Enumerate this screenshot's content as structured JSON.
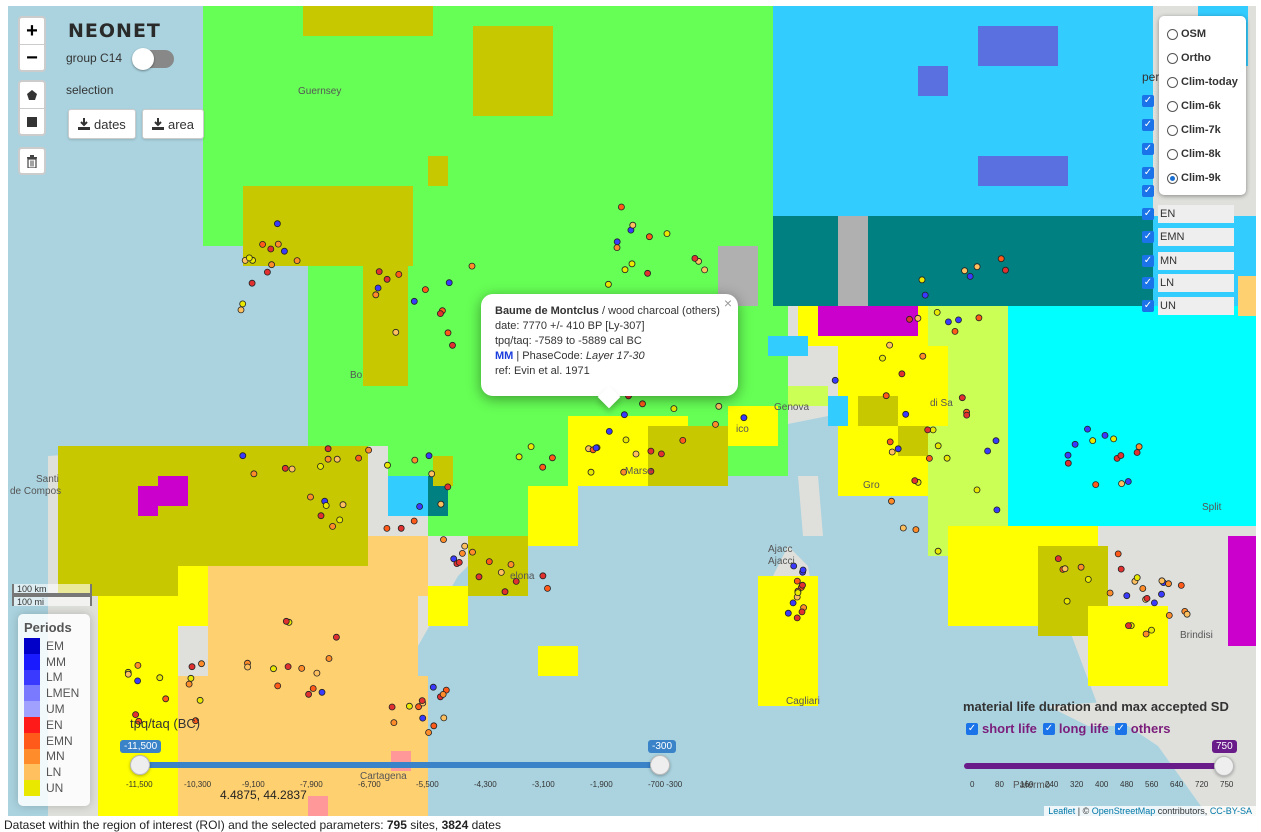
{
  "logo": {
    "part1": "NEO",
    "part2": "NET"
  },
  "controls": {
    "zoom_in": "+",
    "zoom_out": "−",
    "group_label": "group C14",
    "selection_label": "selection",
    "dates_button": "dates",
    "area_button": "area"
  },
  "layers": [
    "OSM",
    "Ortho",
    "Clim-today",
    "Clim-6k",
    "Clim-7k",
    "Clim-8k",
    "Clim-9k"
  ],
  "selected_layer": "Clim-9k",
  "period_panel": {
    "header": "per",
    "rows": [
      "EN",
      "EMN",
      "MN",
      "LN",
      "UN"
    ]
  },
  "popup": {
    "site": "Baume de Montclus",
    "material": " / wood charcoal (others)",
    "date_line": "date: 7770 +/- 410 BP [Ly-307]",
    "tpq_line": "tpq/taq: -7589 to -5889 cal BC",
    "period": "MM",
    "phase_label": " | PhaseCode: ",
    "phase_value": "Layer 17-30",
    "ref_line": "ref: Evin et al. 1971",
    "close": "×"
  },
  "scale": {
    "km": "100 km",
    "mi": "100 mi"
  },
  "legend": {
    "title": "Periods",
    "items": [
      {
        "label": "EM",
        "color": "#0000c8"
      },
      {
        "label": "MM",
        "color": "#1a1aff"
      },
      {
        "label": "LM",
        "color": "#3a3aff"
      },
      {
        "label": "LMEN",
        "color": "#7a7aff"
      },
      {
        "label": "UM",
        "color": "#a0a0ff"
      },
      {
        "label": "EN",
        "color": "#ff1a1a"
      },
      {
        "label": "EMN",
        "color": "#ff5a1a"
      },
      {
        "label": "MN",
        "color": "#ff8c2a"
      },
      {
        "label": "LN",
        "color": "#ffc060"
      },
      {
        "label": "UN",
        "color": "#e8e800"
      }
    ]
  },
  "tpq_slider": {
    "label": "tpq/taq (BC)",
    "min_tag": "-11,500",
    "max_tag": "-300",
    "ticks": [
      "-11,500",
      "-10,300",
      "-9,100",
      "-7,900",
      "-6,700",
      "-5,500",
      "-4,300",
      "-3,100",
      "-1,900",
      "-700 -300"
    ]
  },
  "coords": "4.4875, 44.2837",
  "mld": {
    "label": "material life duration and max accepted SD",
    "short": "short life",
    "long": "long life",
    "others": "others",
    "max_tag": "750",
    "ticks": [
      "0",
      "80",
      "160",
      "240",
      "320",
      "400",
      "480",
      "560",
      "640",
      "720",
      "750"
    ]
  },
  "cities": [
    {
      "name": "Guernsey"
    },
    {
      "name": "Bo"
    },
    {
      "name": "Santi"
    },
    {
      "name": "de Compos"
    },
    {
      "name": "Marse"
    },
    {
      "name": "Genova"
    },
    {
      "name": "Ajacc"
    },
    {
      "name": "Ajacci"
    },
    {
      "name": "Cagliari"
    },
    {
      "name": "Palermo"
    },
    {
      "name": "Brindisi"
    },
    {
      "name": "Cartagena"
    },
    {
      "name": "elona"
    },
    {
      "name": "Gro"
    },
    {
      "name": "di Sa"
    },
    {
      "name": "ico"
    },
    {
      "name": "Split"
    }
  ],
  "attribution": {
    "leaflet": "Leaflet",
    "mid": " | © ",
    "osm": "OpenStreetMap",
    "contrib": " contributors, ",
    "license": "CC-BY-SA"
  },
  "footer": {
    "text": "Dataset within the region of interest (ROI) and the selected parameters: ",
    "sites": "795",
    "sites_label": " sites, ",
    "dates": "3824",
    "dates_label": " dates"
  }
}
